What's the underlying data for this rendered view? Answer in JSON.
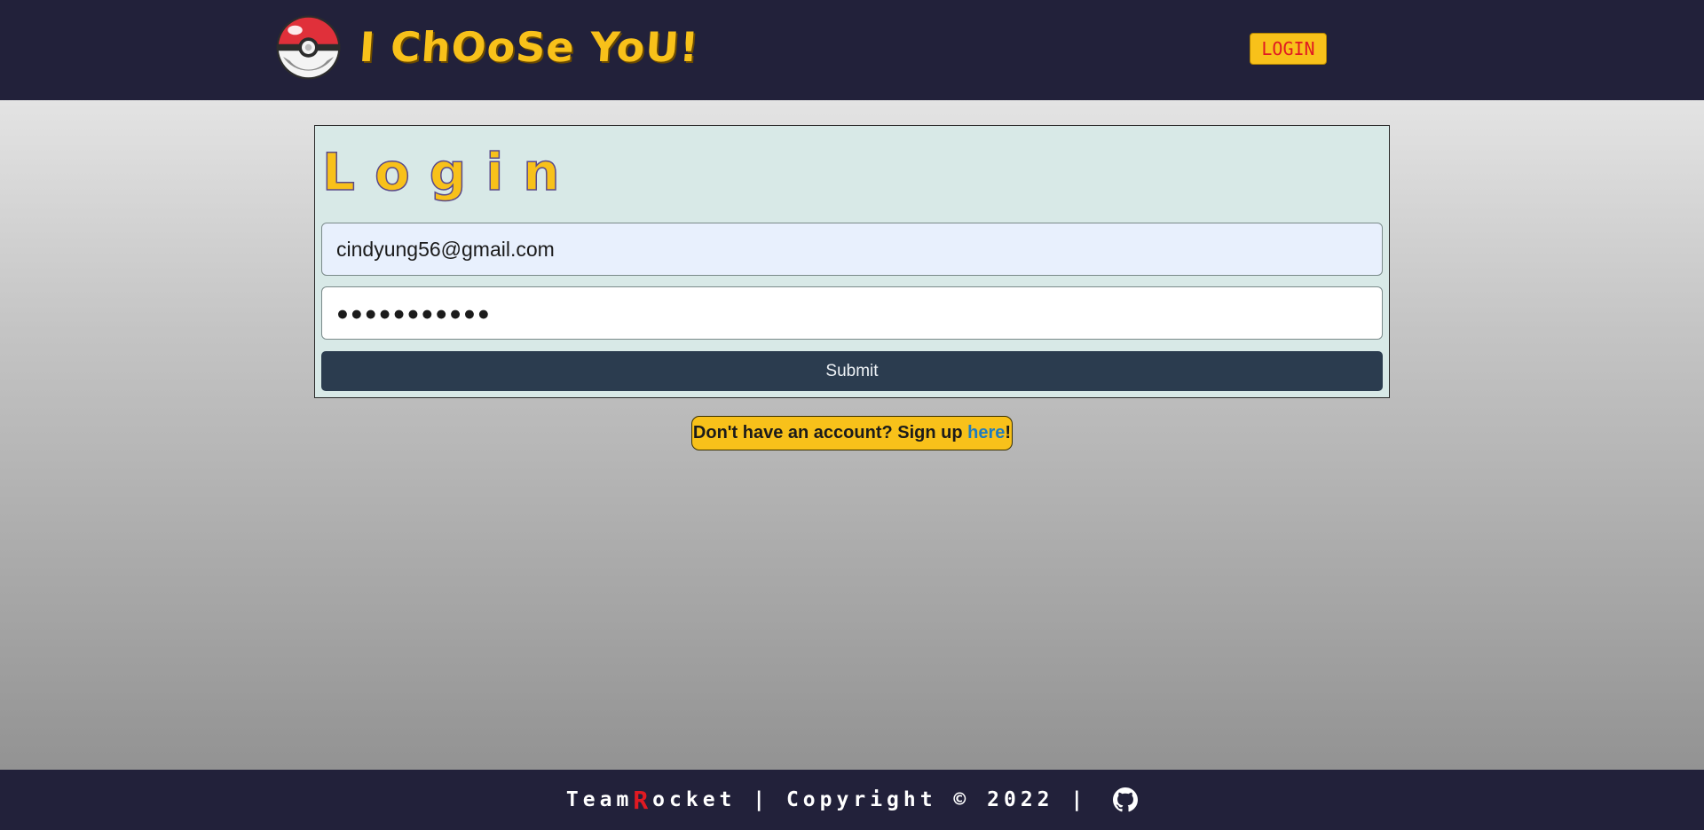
{
  "header": {
    "brand_title": "I ChOoSe YoU!",
    "login_button": "LOGIN"
  },
  "login_card": {
    "title": "Login",
    "email_value": "cindyung56@gmail.com",
    "password_value": "●●●●●●●●●●●",
    "submit_label": "Submit"
  },
  "signup": {
    "prefix": "Don't have an account? Sign up ",
    "link_text": "here",
    "suffix": "!"
  },
  "footer": {
    "team_prefix": "Team ",
    "team_initial": "R",
    "team_rest": "ocket",
    "copyright": " | Copyright © 2022 | "
  },
  "icons": {
    "logo": "pokeball-icon",
    "github": "github-icon"
  },
  "colors": {
    "header_bg": "#22213a",
    "accent_yellow": "#f8c11a",
    "accent_red": "#e01a22",
    "card_bg": "#d8e9e7",
    "submit_bg": "#2b3c4f",
    "link_blue": "#1f7cbf"
  }
}
